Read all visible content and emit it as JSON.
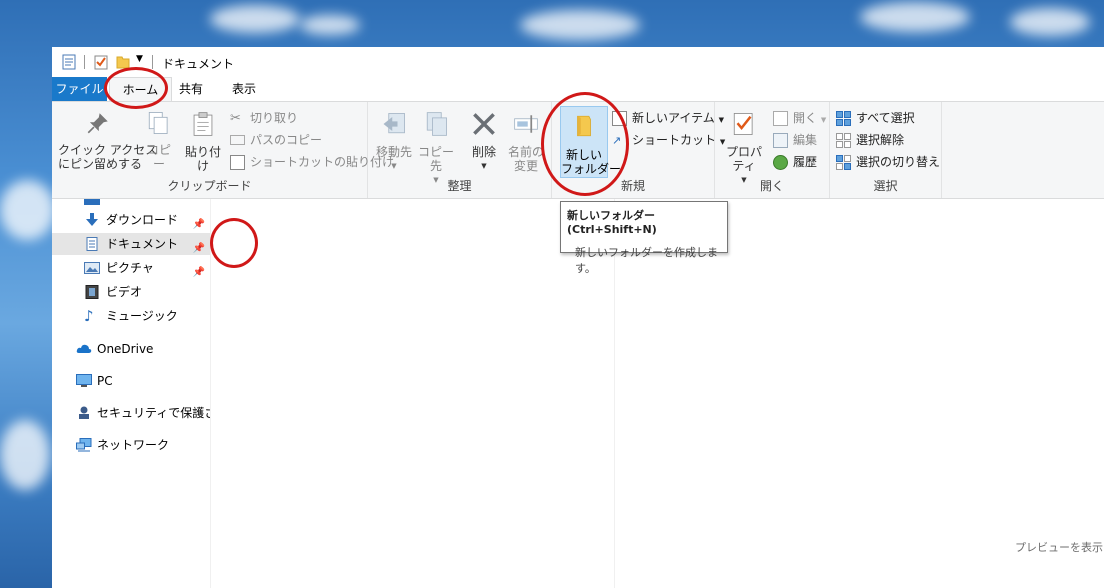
{
  "window": {
    "title": "ドキュメント"
  },
  "tabs": {
    "file": "ファイル",
    "home": "ホーム",
    "share": "共有",
    "view": "表示"
  },
  "ribbon": {
    "clipboard": {
      "label": "クリップボード",
      "pin_quick_access": "クイック アクセス\nにピン留めする",
      "copy": "コピー",
      "paste": "貼り付け",
      "cut": "切り取り",
      "copy_path": "パスのコピー",
      "paste_shortcut": "ショートカットの貼り付け"
    },
    "organize": {
      "label": "整理",
      "move_to": "移動先",
      "copy_to": "コピー先",
      "delete": "削除",
      "rename": "名前の\n変更"
    },
    "new": {
      "label": "新規",
      "new_folder": "新しい\nフォルダー",
      "new_item": "新しいアイテム",
      "shortcut": "ショートカット"
    },
    "open": {
      "label": "開く",
      "properties": "プロパティ",
      "open": "開く",
      "edit": "編集",
      "history": "履歴"
    },
    "select": {
      "label": "選択",
      "select_all": "すべて選択",
      "select_none": "選択解除",
      "invert": "選択の切り替え"
    }
  },
  "tooltip": {
    "title": "新しいフォルダー (Ctrl+Shift+N)",
    "description": "新しいフォルダーを作成します。"
  },
  "sidebar": {
    "items": [
      {
        "label": "ダウンロード",
        "icon": "download-icon",
        "pinned": true
      },
      {
        "label": "ドキュメント",
        "icon": "document-icon",
        "pinned": true,
        "selected": true
      },
      {
        "label": "ピクチャ",
        "icon": "pictures-icon",
        "pinned": true
      },
      {
        "label": "ビデオ",
        "icon": "video-icon",
        "pinned": false
      },
      {
        "label": "ミュージック",
        "icon": "music-icon",
        "pinned": false
      }
    ],
    "roots": [
      {
        "label": "OneDrive",
        "icon": "cloud-icon"
      },
      {
        "label": "PC",
        "icon": "monitor-icon"
      },
      {
        "label": "セキュリティで保護された",
        "icon": "secure-location-icon"
      },
      {
        "label": "ネットワーク",
        "icon": "network-icon"
      }
    ]
  },
  "preview": {
    "text": "プレビューを表示する"
  },
  "colors": {
    "accent": "#1979ca",
    "annotation": "#d01818",
    "ribbon_bg": "#f5f6f7",
    "selected": "#cce4f7"
  }
}
